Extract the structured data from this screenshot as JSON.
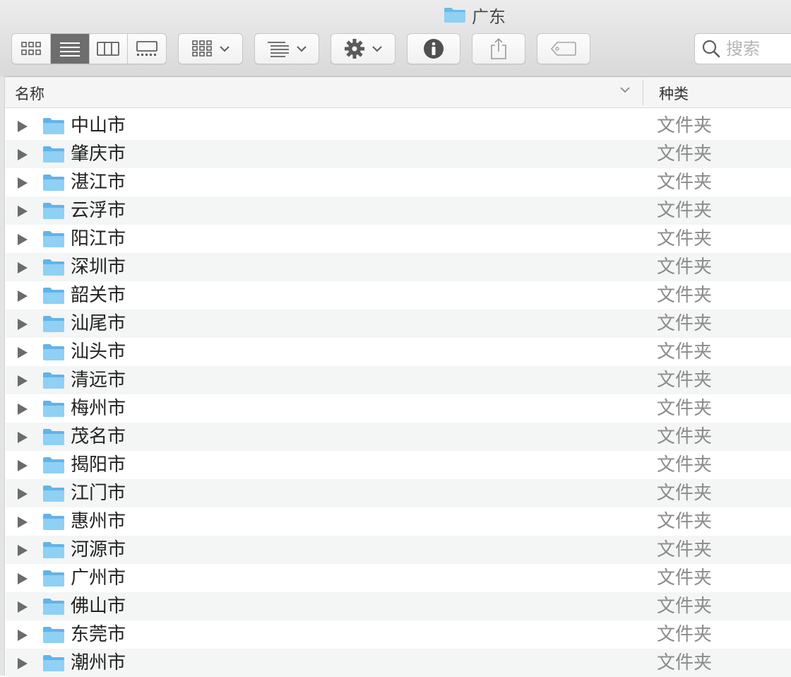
{
  "window": {
    "title": "广东",
    "title_icon": "folder-icon"
  },
  "toolbar": {
    "view_modes": [
      {
        "icon": "icon-view-icon",
        "active": false
      },
      {
        "icon": "list-view-icon",
        "active": true
      },
      {
        "icon": "column-view-icon",
        "active": false
      },
      {
        "icon": "gallery-view-icon",
        "active": false
      }
    ],
    "buttons": [
      {
        "icon": "arrange-grid-icon",
        "dropdown": true
      },
      {
        "icon": "sort-lines-icon",
        "dropdown": true
      },
      {
        "icon": "gear-icon",
        "dropdown": true
      },
      {
        "icon": "info-icon",
        "dropdown": false
      },
      {
        "icon": "share-icon",
        "dropdown": false
      },
      {
        "icon": "tag-icon",
        "dropdown": false
      }
    ],
    "search": {
      "placeholder": "搜索",
      "value": "",
      "icon": "search-icon"
    }
  },
  "columns": {
    "name": "名称",
    "kind": "种类",
    "sort_icon": "chevron-down-icon"
  },
  "colors": {
    "selected_segment": "#6e6e6e",
    "folder_blue": "#7cc4f0",
    "kind_text": "#8b8b8b"
  },
  "files": [
    {
      "name": "中山市",
      "kind": "文件夹"
    },
    {
      "name": "肇庆市",
      "kind": "文件夹"
    },
    {
      "name": "湛江市",
      "kind": "文件夹"
    },
    {
      "name": "云浮市",
      "kind": "文件夹"
    },
    {
      "name": "阳江市",
      "kind": "文件夹"
    },
    {
      "name": "深圳市",
      "kind": "文件夹"
    },
    {
      "name": "韶关市",
      "kind": "文件夹"
    },
    {
      "name": "汕尾市",
      "kind": "文件夹"
    },
    {
      "name": "汕头市",
      "kind": "文件夹"
    },
    {
      "name": "清远市",
      "kind": "文件夹"
    },
    {
      "name": "梅州市",
      "kind": "文件夹"
    },
    {
      "name": "茂名市",
      "kind": "文件夹"
    },
    {
      "name": "揭阳市",
      "kind": "文件夹"
    },
    {
      "name": "江门市",
      "kind": "文件夹"
    },
    {
      "name": "惠州市",
      "kind": "文件夹"
    },
    {
      "name": "河源市",
      "kind": "文件夹"
    },
    {
      "name": "广州市",
      "kind": "文件夹"
    },
    {
      "name": "佛山市",
      "kind": "文件夹"
    },
    {
      "name": "东莞市",
      "kind": "文件夹"
    },
    {
      "name": "潮州市",
      "kind": "文件夹"
    }
  ]
}
